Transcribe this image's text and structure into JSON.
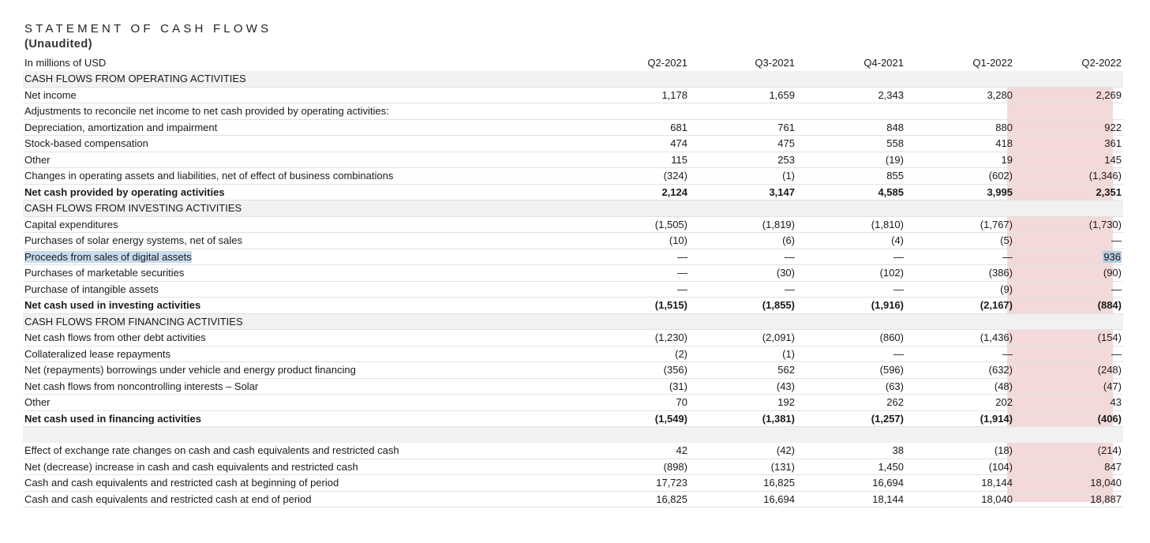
{
  "header": {
    "title": "STATEMENT OF CASH FLOWS",
    "subtitle": "(Unaudited)",
    "units": "In millions of USD",
    "periods": [
      "Q2-2021",
      "Q3-2021",
      "Q4-2021",
      "Q1-2022",
      "Q2-2022"
    ]
  },
  "colors": {
    "highlight_column": "#f3d9d9",
    "selection": "#c7dbef",
    "section_band": "#f1f1f1"
  },
  "rows": [
    {
      "label": "CASH FLOWS FROM OPERATING ACTIVITIES",
      "type": "section",
      "values": []
    },
    {
      "label": "Net income",
      "type": "row",
      "values": [
        "1,178",
        "1,659",
        "2,343",
        "3,280",
        "2,269"
      ]
    },
    {
      "label": "Adjustments to reconcile net income to net cash provided by operating activities:",
      "type": "row",
      "values": []
    },
    {
      "label": "Depreciation, amortization and impairment",
      "type": "row",
      "values": [
        "681",
        "761",
        "848",
        "880",
        "922"
      ]
    },
    {
      "label": "Stock-based compensation",
      "type": "row",
      "values": [
        "474",
        "475",
        "558",
        "418",
        "361"
      ]
    },
    {
      "label": "Other",
      "type": "row",
      "values": [
        "115",
        "253",
        "(19)",
        "19",
        "145"
      ]
    },
    {
      "label": "Changes in operating assets and liabilities, net of effect of business combinations",
      "type": "row",
      "values": [
        "(324)",
        "(1)",
        "855",
        "(602)",
        "(1,346)"
      ]
    },
    {
      "label": "Net cash provided by operating activities",
      "type": "total",
      "values": [
        "2,124",
        "3,147",
        "4,585",
        "3,995",
        "2,351"
      ]
    },
    {
      "label": "CASH FLOWS FROM INVESTING ACTIVITIES",
      "type": "section",
      "values": []
    },
    {
      "label": "Capital expenditures",
      "type": "row",
      "values": [
        "(1,505)",
        "(1,819)",
        "(1,810)",
        "(1,767)",
        "(1,730)"
      ]
    },
    {
      "label": "Purchases of solar energy systems, net of sales",
      "type": "row",
      "values": [
        "(10)",
        "(6)",
        "(4)",
        "(5)",
        "—"
      ]
    },
    {
      "label": "Proceeds from sales of digital assets",
      "type": "row",
      "selected": true,
      "values": [
        "—",
        "—",
        "—",
        "—",
        "936"
      ]
    },
    {
      "label": "Purchases of marketable securities",
      "type": "row",
      "values": [
        "—",
        "(30)",
        "(102)",
        "(386)",
        "(90)"
      ]
    },
    {
      "label": "Purchase of intangible assets",
      "type": "row",
      "values": [
        "—",
        "—",
        "—",
        "(9)",
        "—"
      ]
    },
    {
      "label": "Net cash used in investing activities",
      "type": "total",
      "values": [
        "(1,515)",
        "(1,855)",
        "(1,916)",
        "(2,167)",
        "(884)"
      ]
    },
    {
      "label": "CASH FLOWS FROM FINANCING ACTIVITIES",
      "type": "section",
      "values": []
    },
    {
      "label": "Net cash flows from other debt activities",
      "type": "row",
      "values": [
        "(1,230)",
        "(2,091)",
        "(860)",
        "(1,436)",
        "(154)"
      ]
    },
    {
      "label": "Collateralized lease repayments",
      "type": "row",
      "values": [
        "(2)",
        "(1)",
        "—",
        "—",
        "—"
      ]
    },
    {
      "label": "Net (repayments) borrowings under vehicle and energy product financing",
      "type": "row",
      "values": [
        "(356)",
        "562",
        "(596)",
        "(632)",
        "(248)"
      ]
    },
    {
      "label": "Net cash flows from noncontrolling interests – Solar",
      "type": "row",
      "values": [
        "(31)",
        "(43)",
        "(63)",
        "(48)",
        "(47)"
      ]
    },
    {
      "label": "Other",
      "type": "row",
      "values": [
        "70",
        "192",
        "262",
        "202",
        "43"
      ]
    },
    {
      "label": "Net cash used in financing activities",
      "type": "total",
      "values": [
        "(1,549)",
        "(1,381)",
        "(1,257)",
        "(1,914)",
        "(406)"
      ]
    },
    {
      "label": "",
      "type": "blank",
      "values": []
    },
    {
      "label": "Effect of exchange rate changes on cash and cash equivalents and restricted cash",
      "type": "row",
      "values": [
        "42",
        "(42)",
        "38",
        "(18)",
        "(214)"
      ]
    },
    {
      "label": "Net (decrease) increase in cash and cash equivalents and restricted cash",
      "type": "row",
      "values": [
        "(898)",
        "(131)",
        "1,450",
        "(104)",
        "847"
      ]
    },
    {
      "label": "Cash and cash equivalents and restricted cash at beginning of period",
      "type": "row",
      "values": [
        "17,723",
        "16,825",
        "16,694",
        "18,144",
        "18,040"
      ]
    },
    {
      "label": "Cash and cash equivalents and restricted cash at end of period",
      "type": "row",
      "values": [
        "16,825",
        "16,694",
        "18,144",
        "18,040",
        "18,887"
      ]
    }
  ]
}
